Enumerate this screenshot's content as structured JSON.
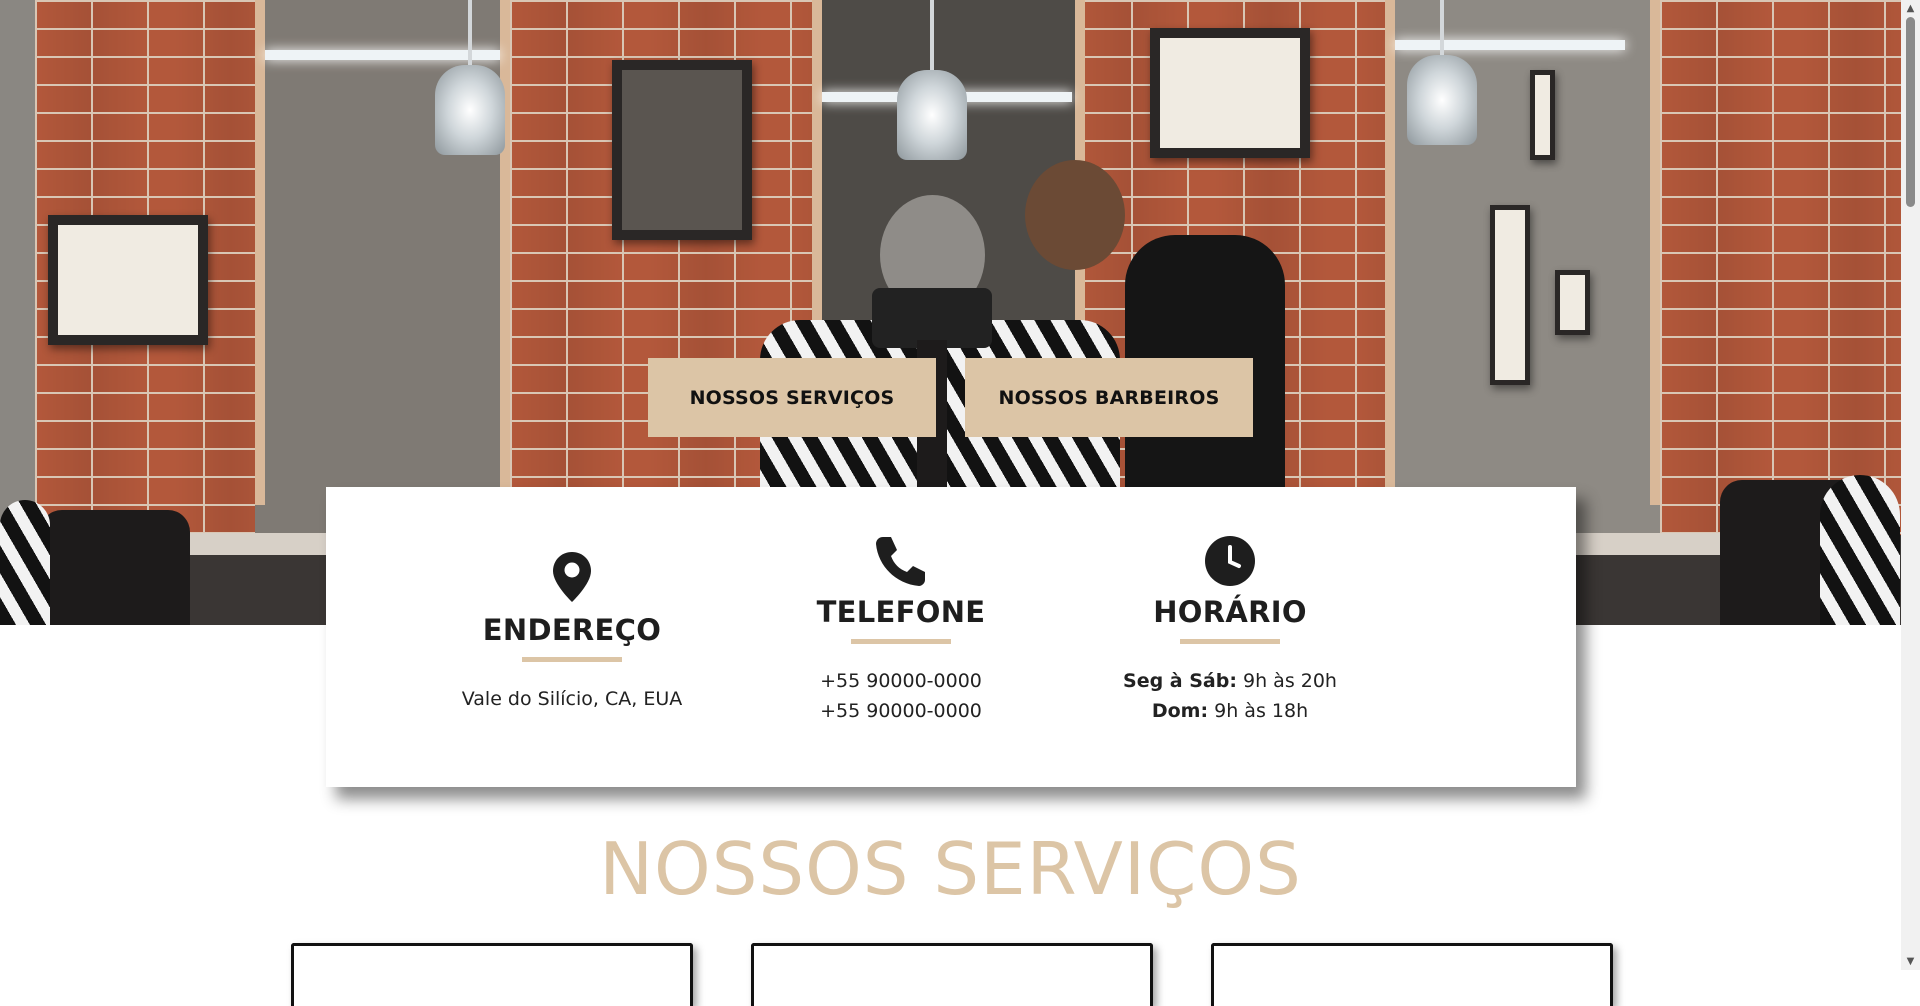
{
  "hero": {
    "buttons": {
      "services_label": "NOSSOS SERVIÇOS",
      "barbers_label": "NOSSOS BARBEIROS"
    }
  },
  "info": {
    "address": {
      "icon": "map-pin-icon",
      "title": "ENDEREÇO",
      "lines": [
        "Vale do Silício, CA, EUA"
      ]
    },
    "phone": {
      "icon": "phone-icon",
      "title": "TELEFONE",
      "lines": [
        "+55 90000-0000",
        "+55 90000-0000"
      ]
    },
    "hours": {
      "icon": "clock-icon",
      "title": "HORÁRIO",
      "rows": [
        {
          "day": "Seg à Sáb:",
          "time": "9h às 20h"
        },
        {
          "day": "Dom:",
          "time": "9h às 18h"
        }
      ]
    }
  },
  "services": {
    "title": "NOSSOS SERVIÇOS"
  },
  "colors": {
    "accent": "#dcc5a6",
    "text_dark": "#1e1e1e",
    "card_bg": "#ffffff"
  }
}
